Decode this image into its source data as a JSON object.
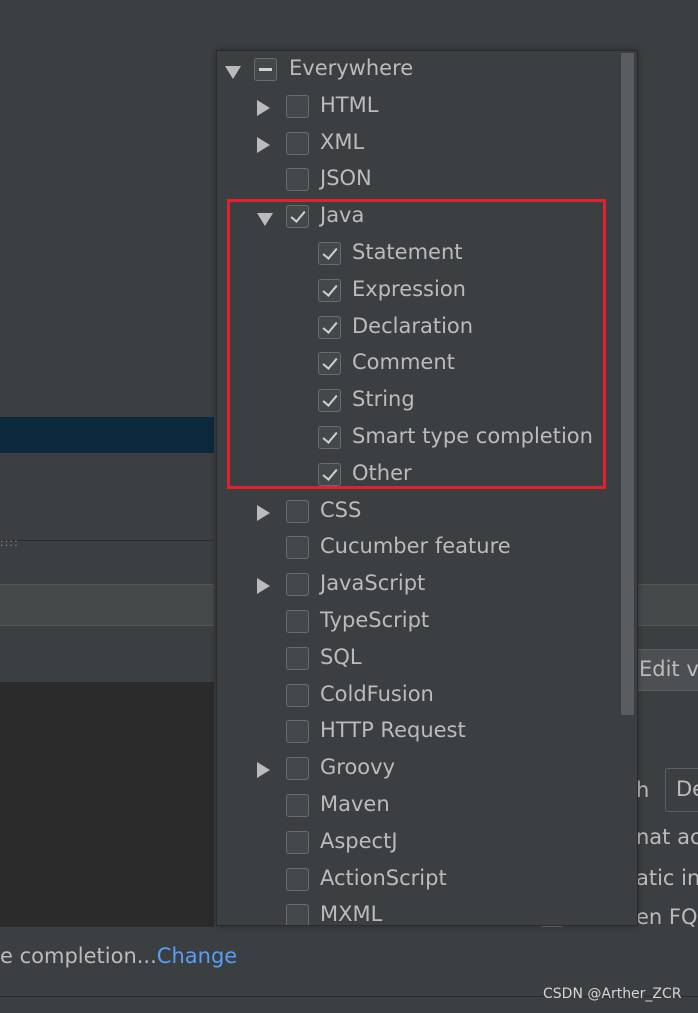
{
  "popup": {
    "root": {
      "label": "Everywhere",
      "state": "partial",
      "expanded": true
    },
    "items": [
      {
        "label": "HTML",
        "state": "unchecked",
        "arrow": "right",
        "level": 1
      },
      {
        "label": "XML",
        "state": "unchecked",
        "arrow": "right",
        "level": 1
      },
      {
        "label": "JSON",
        "state": "unchecked",
        "arrow": "none",
        "level": 1
      },
      {
        "label": "Java",
        "state": "checked",
        "arrow": "down",
        "level": 1
      },
      {
        "label": "Statement",
        "state": "checked",
        "arrow": "none",
        "level": 2
      },
      {
        "label": "Expression",
        "state": "checked",
        "arrow": "none",
        "level": 2
      },
      {
        "label": "Declaration",
        "state": "checked",
        "arrow": "none",
        "level": 2
      },
      {
        "label": "Comment",
        "state": "checked",
        "arrow": "none",
        "level": 2
      },
      {
        "label": "String",
        "state": "checked",
        "arrow": "none",
        "level": 2
      },
      {
        "label": "Smart type completion",
        "state": "checked",
        "arrow": "none",
        "level": 2
      },
      {
        "label": "Other",
        "state": "checked",
        "arrow": "none",
        "level": 2
      },
      {
        "label": "CSS",
        "state": "unchecked",
        "arrow": "right",
        "level": 1
      },
      {
        "label": "Cucumber feature",
        "state": "unchecked",
        "arrow": "none",
        "level": 1
      },
      {
        "label": "JavaScript",
        "state": "unchecked",
        "arrow": "right",
        "level": 1
      },
      {
        "label": "TypeScript",
        "state": "unchecked",
        "arrow": "none",
        "level": 1
      },
      {
        "label": "SQL",
        "state": "unchecked",
        "arrow": "none",
        "level": 1
      },
      {
        "label": "ColdFusion",
        "state": "unchecked",
        "arrow": "none",
        "level": 1
      },
      {
        "label": "HTTP Request",
        "state": "unchecked",
        "arrow": "none",
        "level": 1
      },
      {
        "label": "Groovy",
        "state": "unchecked",
        "arrow": "right",
        "level": 1
      },
      {
        "label": "Maven",
        "state": "unchecked",
        "arrow": "none",
        "level": 1
      },
      {
        "label": "AspectJ",
        "state": "unchecked",
        "arrow": "none",
        "level": 1
      },
      {
        "label": "ActionScript",
        "state": "unchecked",
        "arrow": "none",
        "level": 1
      },
      {
        "label": "MXML",
        "state": "unchecked",
        "arrow": "none",
        "level": 1
      }
    ]
  },
  "background": {
    "edit_button_label": "Edit va",
    "line_1": "h",
    "combo_value": "De",
    "line_2": "nat ac",
    "line_3": "atic in",
    "line_4": "en FQ n",
    "dots": "::::",
    "bottom_text": "e completion...",
    "bottom_link": "Change"
  },
  "watermark": "CSDN @Arther_ZCR",
  "colors": {
    "highlight_box": "#e5202e",
    "link": "#589df6",
    "selection_band": "#0d293e"
  }
}
